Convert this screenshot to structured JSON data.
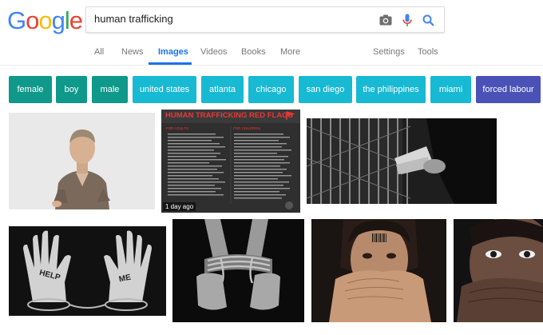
{
  "logo": {
    "letters": [
      "G",
      "o",
      "o",
      "g",
      "l",
      "e"
    ],
    "colors": [
      "#4285F4",
      "#EA4335",
      "#FBBC05",
      "#4285F4",
      "#34A853",
      "#EA4335"
    ]
  },
  "search": {
    "query": "human trafficking"
  },
  "icons": {
    "camera": "camera-icon",
    "mic": "microphone-icon",
    "search": "search-icon"
  },
  "tabs": {
    "all": "All",
    "news": "News",
    "images": "Images",
    "videos": "Videos",
    "books": "Books",
    "more": "More",
    "settings": "Settings",
    "tools": "Tools",
    "active": "Images"
  },
  "chips": [
    {
      "label": "female",
      "color": "#0e998a"
    },
    {
      "label": "boy",
      "color": "#0e998a"
    },
    {
      "label": "male",
      "color": "#0e998a"
    },
    {
      "label": "united states",
      "color": "#17b9d3"
    },
    {
      "label": "atlanta",
      "color": "#17b9d3"
    },
    {
      "label": "chicago",
      "color": "#17b9d3"
    },
    {
      "label": "san diego",
      "color": "#17b9d3"
    },
    {
      "label": "the philippines",
      "color": "#17b9d3"
    },
    {
      "label": "miami",
      "color": "#17b9d3"
    },
    {
      "label": "forced labour",
      "color": "#4a52b8"
    }
  ],
  "images": {
    "infographic_title": "HUMAN TRAFFICKING RED FLAGS",
    "infographic_col_left": "FOR ADULTS",
    "infographic_col_right": "FOR CHILDREN",
    "infographic_age": "1 day ago",
    "hands_text_left": "HELP",
    "hands_text_right": "ME"
  }
}
